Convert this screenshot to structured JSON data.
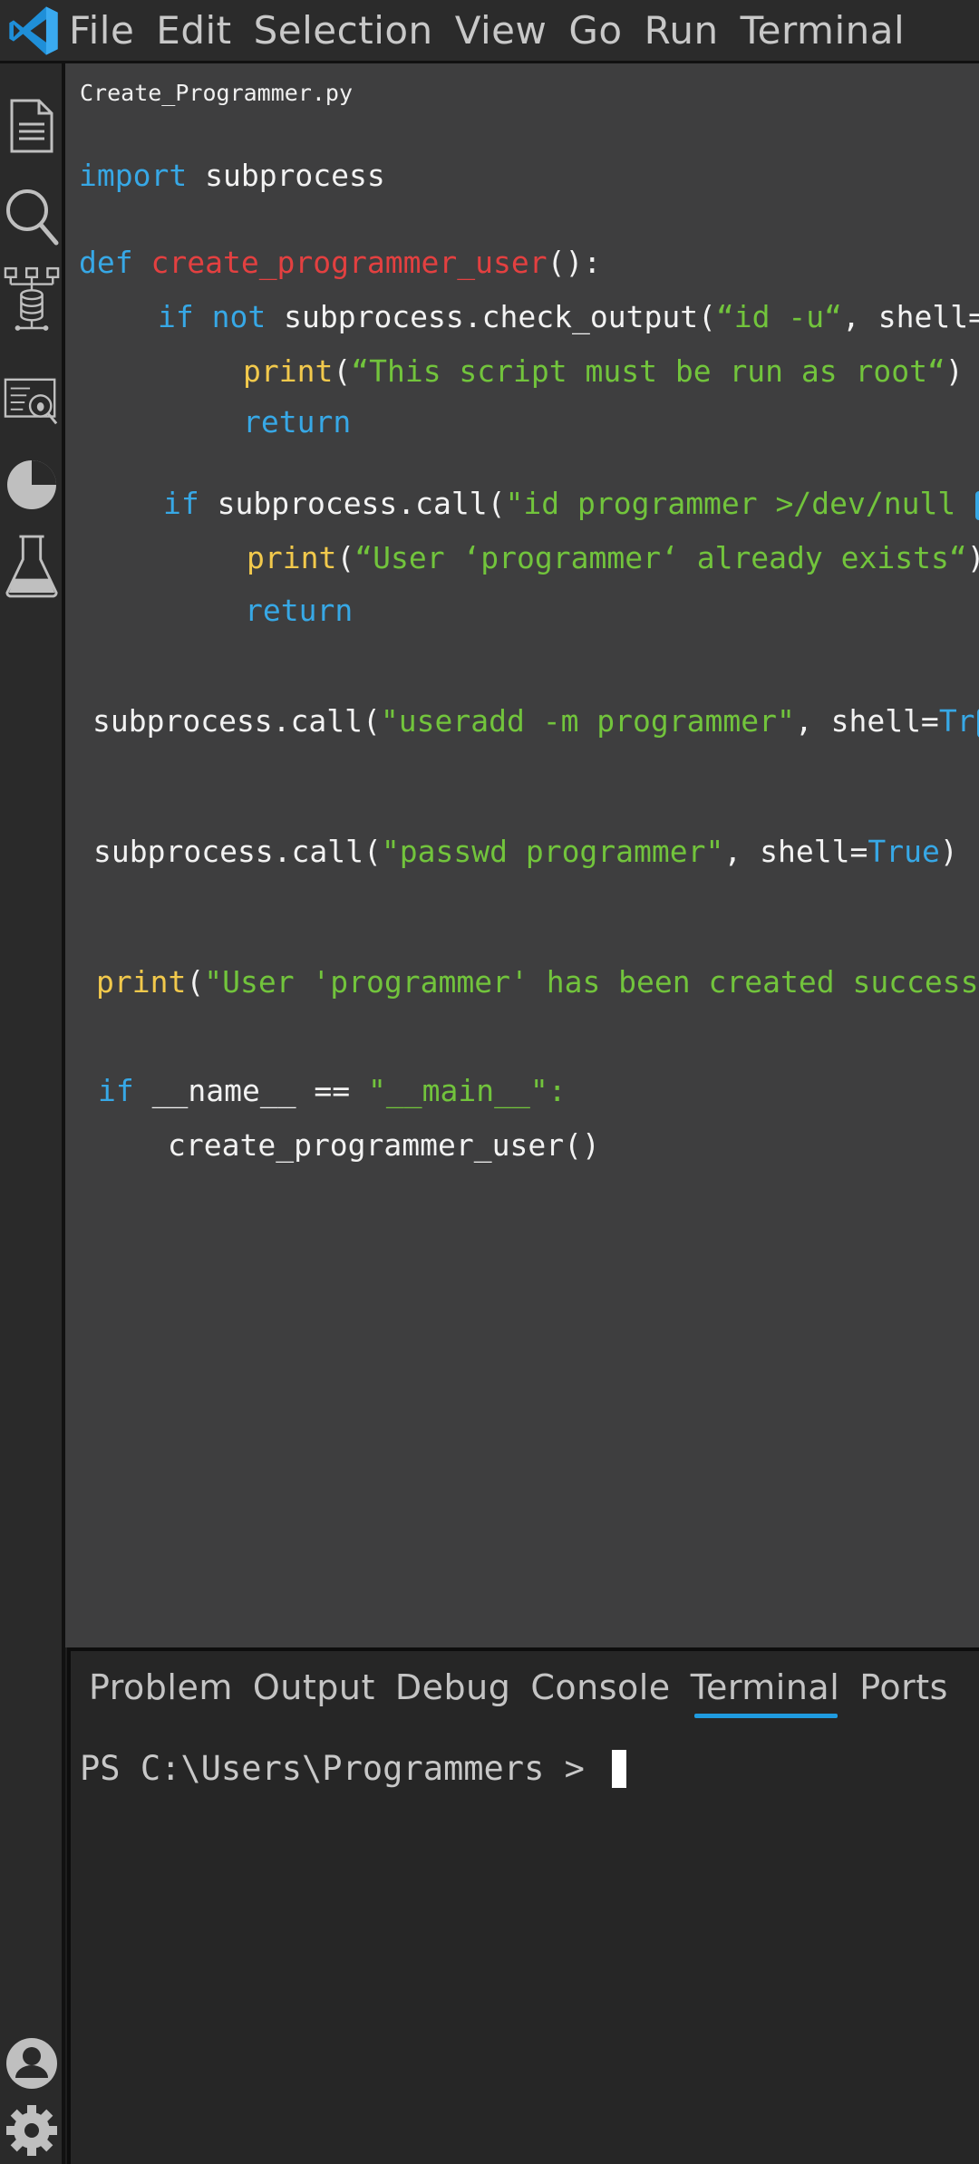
{
  "menubar": {
    "logo_icon": "vscode-logo-icon",
    "items": [
      "File",
      "Edit",
      "Selection",
      "View",
      "Go",
      "Run",
      "Terminal"
    ]
  },
  "activitybar": {
    "icons": [
      "explorer-icon",
      "search-icon",
      "source-control-icon",
      "debug-icon",
      "chart-icon",
      "testing-icon",
      "account-icon",
      "settings-gear-icon"
    ]
  },
  "editor": {
    "file_name": "Create_Programmer.py",
    "code": {
      "l1_kw": "import",
      "l1_rest": " subprocess",
      "l2_kw": "def",
      "l2_fn": "create_programmer_user",
      "l2_rest": "():",
      "l3_kw1": "if",
      "l3_kw2": "not",
      "l3_rest": " subprocess.check_output(",
      "l3_str": "“id -u“",
      "l3_tail": ", shell=",
      "l4_bi": "print",
      "l4_open": "(",
      "l4_str": "“This script must be run as root“",
      "l4_close": ")",
      "l5_kw": "return",
      "l6_kw": "if",
      "l6_rest": " subprocess.call(",
      "l6_str": "\"id programmer >/dev/null ",
      "l7_bi": "print",
      "l7_open": "(",
      "l7_str": "“User ‘programmer‘ already exists“",
      "l7_close": ")",
      "l8_kw": "return",
      "l9_rest": "subprocess.call(",
      "l9_str": "\"useradd -m programmer\"",
      "l9_tail": ", shell=",
      "l9_kw": "Tr",
      "l10_rest": "subprocess.call(",
      "l10_str": "\"passwd programmer\"",
      "l10_tail": ", shell=",
      "l10_kw": "True",
      "l10_close": ")",
      "l11_bi": "print",
      "l11_open": "(",
      "l11_str": "\"User 'programmer' has been created success",
      "l12_kw": "if",
      "l12_rest": " __name__ == ",
      "l12_str": "\"__main__\":",
      "l13_rest": "create_programmer_user()"
    }
  },
  "panel": {
    "tabs": [
      "Problem",
      "Output",
      "Debug",
      "Console",
      "Terminal",
      "Ports"
    ],
    "active_tab": "Terminal",
    "terminal_prompt": "PS C:\\Users\\Programmers > "
  },
  "colors": {
    "keyword": "#37a8e6",
    "function": "#e34040",
    "string": "#72c43c",
    "builtin": "#f2c94c",
    "accent": "#1f9be0"
  }
}
